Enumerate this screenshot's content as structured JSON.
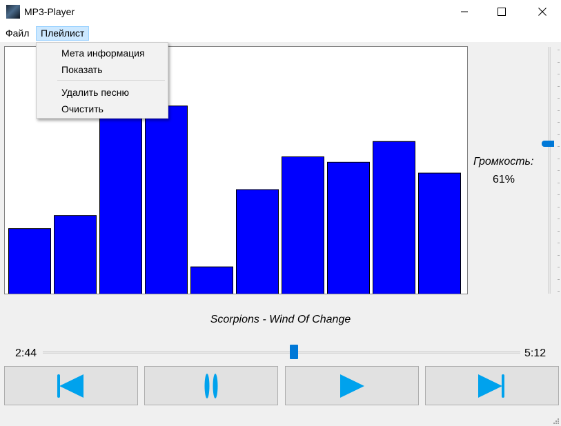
{
  "window": {
    "title": "MP3-Player",
    "controls": [
      "minimize-icon",
      "maximize-icon",
      "close-icon"
    ]
  },
  "menubar": {
    "items": [
      {
        "label": "Файл",
        "active": false
      },
      {
        "label": "Плейлист",
        "active": true
      }
    ]
  },
  "dropdown": {
    "items": [
      {
        "label": "Мета информация"
      },
      {
        "label": "Показать"
      },
      {
        "label": "Удалить песню"
      },
      {
        "label": "Очистить"
      }
    ]
  },
  "chart_data": {
    "type": "bar",
    "values": [
      0.265,
      0.318,
      0.738,
      0.762,
      0.11,
      0.423,
      0.556,
      0.534,
      0.618,
      0.49
    ],
    "ylim": [
      0,
      1
    ],
    "bar_color": "#0000ff",
    "bar_stroke": "#000000"
  },
  "volume": {
    "label": "Громкость:",
    "value_text": "61%",
    "level": 0.61,
    "accent": "#0078d7"
  },
  "song": {
    "title": "Scorpions - Wind Of Change"
  },
  "seek": {
    "current": "2:44",
    "total": "5:12",
    "position": 0.526
  },
  "controls": [
    {
      "name": "previous-button",
      "icon": "skip-previous-icon"
    },
    {
      "name": "pause-button",
      "icon": "pause-icon"
    },
    {
      "name": "play-button",
      "icon": "play-icon"
    },
    {
      "name": "next-button",
      "icon": "skip-next-icon"
    }
  ],
  "colors": {
    "accent": "#0078d7",
    "icon_blue": "#00a2ed",
    "menu_highlight": "#cce8ff"
  }
}
